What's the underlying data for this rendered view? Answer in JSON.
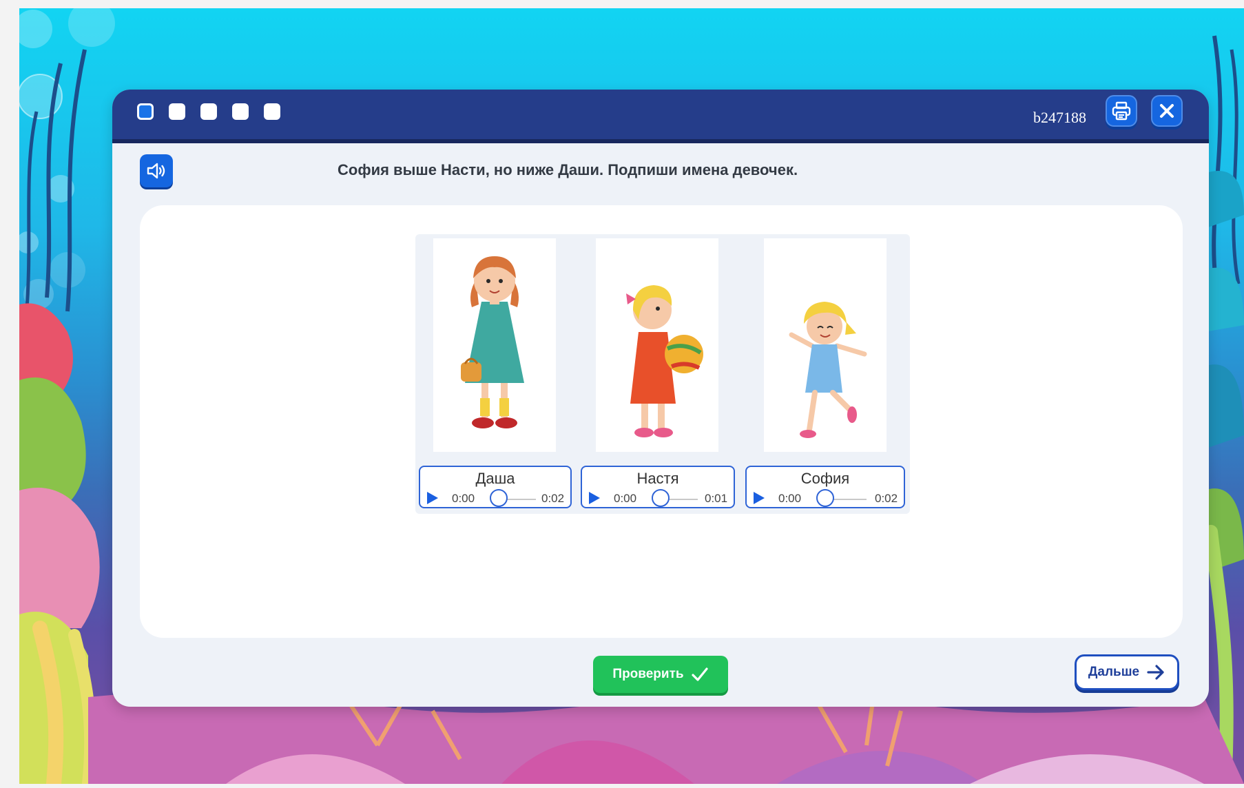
{
  "header": {
    "progress_dots": [
      {
        "state": "active"
      },
      {
        "state": "inactive"
      },
      {
        "state": "inactive"
      },
      {
        "state": "inactive"
      },
      {
        "state": "inactive"
      }
    ],
    "task_id": "b247188",
    "print_icon": "printer-icon",
    "close_icon": "close-icon"
  },
  "question": {
    "speaker_icon": "speaker-icon",
    "text": "София выше Насти, но ниже Даши. Подпиши имена девочек."
  },
  "cards": [
    {
      "name": "Даша",
      "time_current": "0:00",
      "time_total": "0:02"
    },
    {
      "name": "Настя",
      "time_current": "0:00",
      "time_total": "0:01"
    },
    {
      "name": "София",
      "time_current": "0:00",
      "time_total": "0:02"
    }
  ],
  "footer": {
    "check_label": "Проверить",
    "next_label": "Дальше"
  },
  "colors": {
    "header": "#253d8a",
    "accent_blue": "#1566e0",
    "check_green": "#21c25a"
  }
}
